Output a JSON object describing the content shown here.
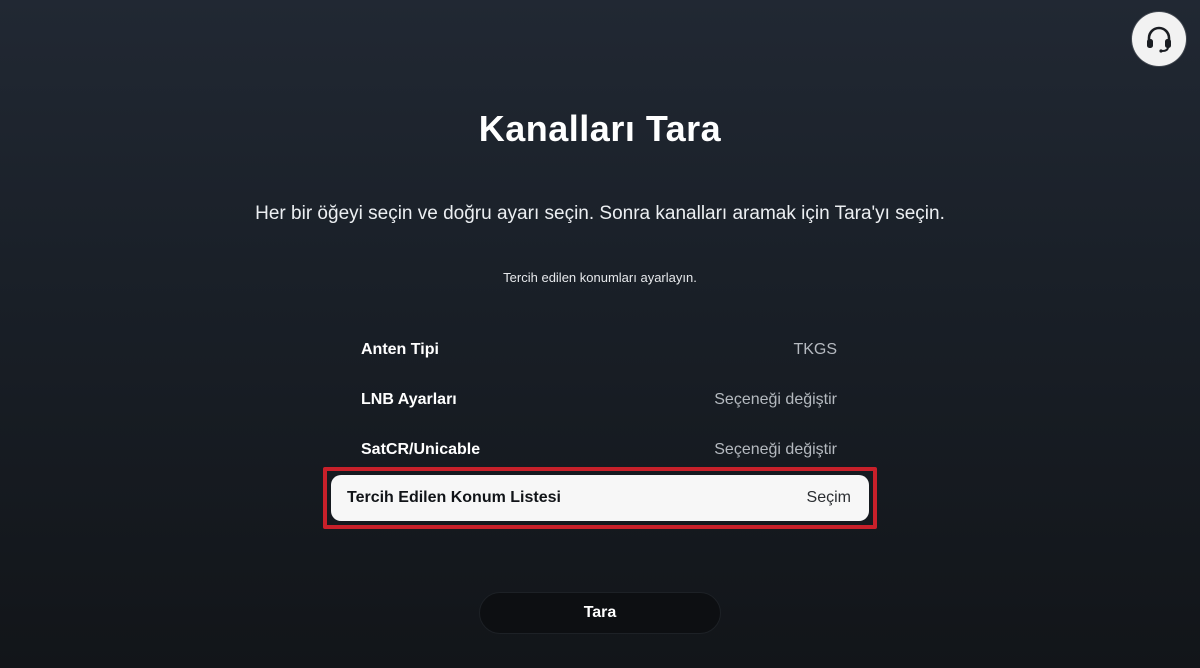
{
  "header": {
    "help_icon": "headset-icon"
  },
  "page": {
    "title": "Kanalları Tara",
    "instruction": "Her bir öğeyi seçin ve doğru ayarı seçin. Sonra kanalları aramak için Tara'yı seçin.",
    "sub_instruction": "Tercih edilen konumları ayarlayın."
  },
  "settings": {
    "items": [
      {
        "label": "Anten Tipi",
        "value": "TKGS"
      },
      {
        "label": "LNB Ayarları",
        "value": "Seçeneği değiştir"
      },
      {
        "label": "SatCR/Unicable",
        "value": "Seçeneği değiştir"
      },
      {
        "label": "Tercih Edilen Konum Listesi",
        "value": "Seçim"
      }
    ],
    "selected_index": 3
  },
  "footer": {
    "scan_label": "Tara"
  },
  "colors": {
    "highlight_border": "#c8202a",
    "selected_row_bg": "#f7f7f7",
    "background_top": "#212833",
    "background_bottom": "#121519"
  }
}
